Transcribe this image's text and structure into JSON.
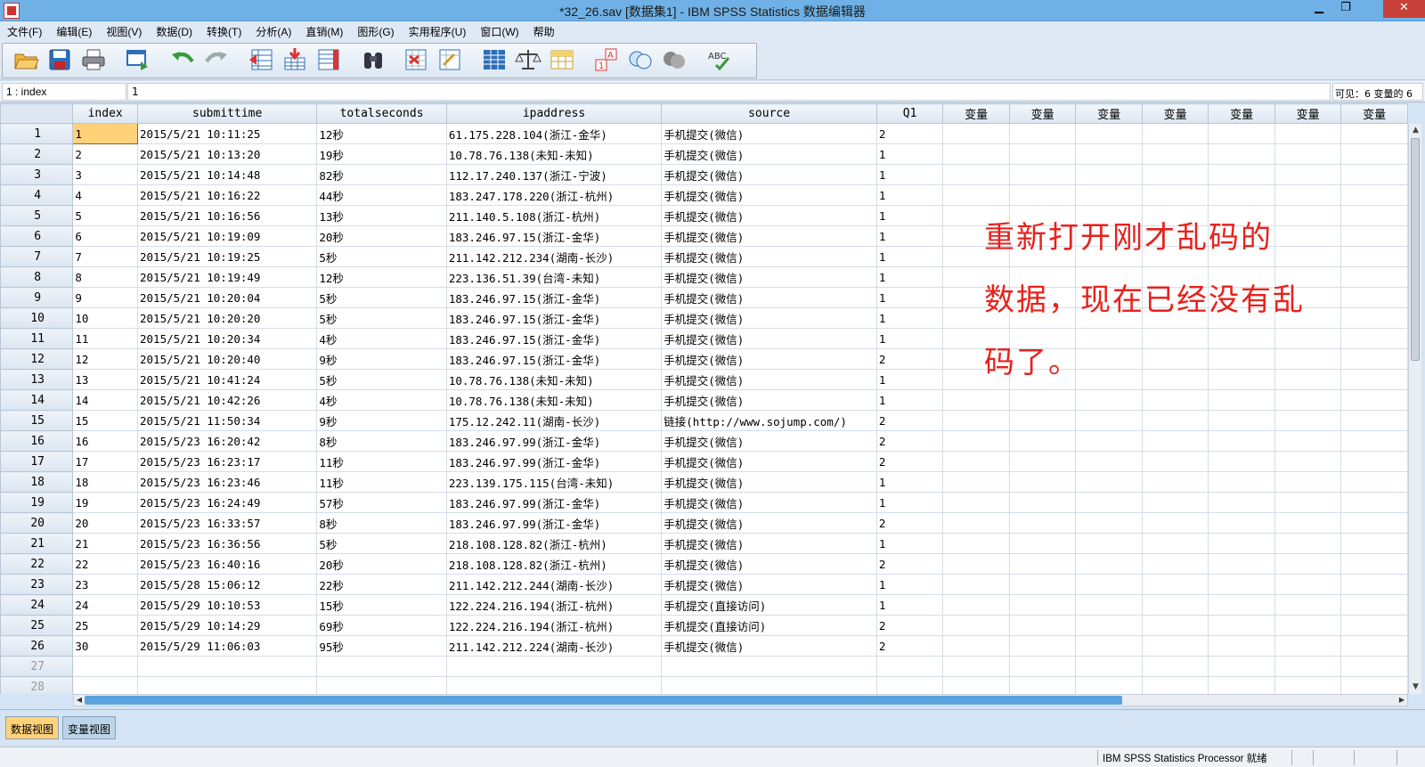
{
  "window": {
    "title": "*32_26.sav [数据集1] - IBM SPSS Statistics 数据编辑器"
  },
  "menu": [
    "文件(F)",
    "编辑(E)",
    "视图(V)",
    "数据(D)",
    "转换(T)",
    "分析(A)",
    "直销(M)",
    "图形(G)",
    "实用程序(U)",
    "窗口(W)",
    "帮助"
  ],
  "toolbar": {
    "icons": [
      "open-icon",
      "save-icon",
      "print-icon",
      "dialog-recall-icon",
      "undo-icon",
      "redo-icon",
      "goto-case-icon",
      "goto-variable-icon",
      "variables-icon",
      "find-icon",
      "insert-cases-icon",
      "insert-variable-icon",
      "split-file-icon",
      "weight-cases-icon",
      "select-cases-icon",
      "value-labels-icon",
      "use-sets-icon",
      "show-all-variables-icon",
      "spell-check-icon"
    ],
    "spell_label": "ABC"
  },
  "editor": {
    "cell_ref": "1 : index",
    "cell_value": "1",
    "visible_info": "可见：6 变量的 6"
  },
  "columns": [
    "index",
    "submittime",
    "totalseconds",
    "ipaddress",
    "source",
    "Q1",
    "变量",
    "变量",
    "变量",
    "变量",
    "变量",
    "变量",
    "变量"
  ],
  "rows": [
    [
      "1",
      "2015/5/21 10:11:25",
      "12秒",
      "61.175.228.104(浙江-金华)",
      "手机提交(微信)",
      "2"
    ],
    [
      "2",
      "2015/5/21 10:13:20",
      "19秒",
      "10.78.76.138(未知-未知)",
      "手机提交(微信)",
      "1"
    ],
    [
      "3",
      "2015/5/21 10:14:48",
      "82秒",
      "112.17.240.137(浙江-宁波)",
      "手机提交(微信)",
      "1"
    ],
    [
      "4",
      "2015/5/21 10:16:22",
      "44秒",
      "183.247.178.220(浙江-杭州)",
      "手机提交(微信)",
      "1"
    ],
    [
      "5",
      "2015/5/21 10:16:56",
      "13秒",
      "211.140.5.108(浙江-杭州)",
      "手机提交(微信)",
      "1"
    ],
    [
      "6",
      "2015/5/21 10:19:09",
      "20秒",
      "183.246.97.15(浙江-金华)",
      "手机提交(微信)",
      "1"
    ],
    [
      "7",
      "2015/5/21 10:19:25",
      "5秒",
      "211.142.212.234(湖南-长沙)",
      "手机提交(微信)",
      "1"
    ],
    [
      "8",
      "2015/5/21 10:19:49",
      "12秒",
      "223.136.51.39(台湾-未知)",
      "手机提交(微信)",
      "1"
    ],
    [
      "9",
      "2015/5/21 10:20:04",
      "5秒",
      "183.246.97.15(浙江-金华)",
      "手机提交(微信)",
      "1"
    ],
    [
      "10",
      "2015/5/21 10:20:20",
      "5秒",
      "183.246.97.15(浙江-金华)",
      "手机提交(微信)",
      "1"
    ],
    [
      "11",
      "2015/5/21 10:20:34",
      "4秒",
      "183.246.97.15(浙江-金华)",
      "手机提交(微信)",
      "1"
    ],
    [
      "12",
      "2015/5/21 10:20:40",
      "9秒",
      "183.246.97.15(浙江-金华)",
      "手机提交(微信)",
      "2"
    ],
    [
      "13",
      "2015/5/21 10:41:24",
      "5秒",
      "10.78.76.138(未知-未知)",
      "手机提交(微信)",
      "1"
    ],
    [
      "14",
      "2015/5/21 10:42:26",
      "4秒",
      "10.78.76.138(未知-未知)",
      "手机提交(微信)",
      "1"
    ],
    [
      "15",
      "2015/5/21 11:50:34",
      "9秒",
      "175.12.242.11(湖南-长沙)",
      "链接(http://www.sojump.com/)",
      "2"
    ],
    [
      "16",
      "2015/5/23 16:20:42",
      "8秒",
      "183.246.97.99(浙江-金华)",
      "手机提交(微信)",
      "2"
    ],
    [
      "17",
      "2015/5/23 16:23:17",
      "11秒",
      "183.246.97.99(浙江-金华)",
      "手机提交(微信)",
      "2"
    ],
    [
      "18",
      "2015/5/23 16:23:46",
      "11秒",
      "223.139.175.115(台湾-未知)",
      "手机提交(微信)",
      "1"
    ],
    [
      "19",
      "2015/5/23 16:24:49",
      "57秒",
      "183.246.97.99(浙江-金华)",
      "手机提交(微信)",
      "1"
    ],
    [
      "20",
      "2015/5/23 16:33:57",
      "8秒",
      "183.246.97.99(浙江-金华)",
      "手机提交(微信)",
      "2"
    ],
    [
      "21",
      "2015/5/23 16:36:56",
      "5秒",
      "218.108.128.82(浙江-杭州)",
      "手机提交(微信)",
      "1"
    ],
    [
      "22",
      "2015/5/23 16:40:16",
      "20秒",
      "218.108.128.82(浙江-杭州)",
      "手机提交(微信)",
      "2"
    ],
    [
      "23",
      "2015/5/28 15:06:12",
      "22秒",
      "211.142.212.244(湖南-长沙)",
      "手机提交(微信)",
      "1"
    ],
    [
      "24",
      "2015/5/29 10:10:53",
      "15秒",
      "122.224.216.194(浙江-杭州)",
      "手机提交(直接访问)",
      "1"
    ],
    [
      "25",
      "2015/5/29 10:14:29",
      "69秒",
      "122.224.216.194(浙江-杭州)",
      "手机提交(直接访问)",
      "2"
    ],
    [
      "30",
      "2015/5/29 11:06:03",
      "95秒",
      "211.142.212.224(湖南-长沙)",
      "手机提交(微信)",
      "2"
    ]
  ],
  "empty_row_numbers": [
    "27",
    "28"
  ],
  "annotation": {
    "lines": [
      "重新打开刚才乱码的",
      "数据，现在已经没有乱",
      "码了。"
    ],
    "color": "#e8211c"
  },
  "tabs": {
    "data_view": "数据视图",
    "variable_view": "变量视图"
  },
  "status": {
    "text": "IBM SPSS Statistics Processor 就绪"
  },
  "colors": {
    "selected_cell": "#ffd27a",
    "title_bar": "#6fb1e6",
    "scroll_thumb": "#5aa2de"
  }
}
